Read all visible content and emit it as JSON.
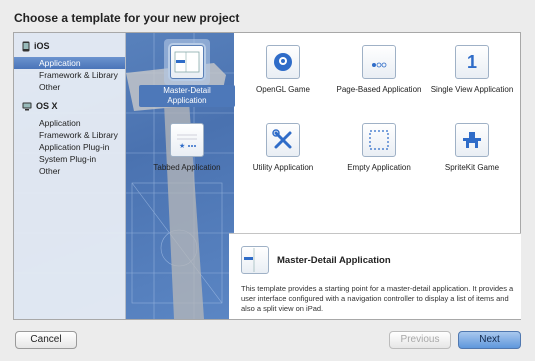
{
  "dialog": {
    "title": "Choose a template for your new project"
  },
  "sidebar": {
    "sections": [
      {
        "name": "iOS",
        "items": [
          "Application",
          "Framework & Library",
          "Other"
        ],
        "selected_index": 0
      },
      {
        "name": "OS X",
        "items": [
          "Application",
          "Framework & Library",
          "Application Plug-in",
          "System Plug-in",
          "Other"
        ]
      }
    ]
  },
  "templates": [
    {
      "label": "Master-Detail Application",
      "icon": "master-detail-icon",
      "selected": true
    },
    {
      "label": "OpenGL Game",
      "icon": "opengl-icon"
    },
    {
      "label": "Page-Based Application",
      "icon": "page-based-icon"
    },
    {
      "label": "Single View Application",
      "icon": "single-view-icon",
      "glyph": "1"
    },
    {
      "label": "Tabbed Application",
      "icon": "tabbed-icon"
    },
    {
      "label": "Utility Application",
      "icon": "utility-icon"
    },
    {
      "label": "Empty Application",
      "icon": "empty-icon"
    },
    {
      "label": "SpriteKit Game",
      "icon": "spritekit-icon"
    }
  ],
  "detail": {
    "title": "Master-Detail Application",
    "description": "This template provides a starting point for a master-detail application. It provides a user interface configured with a navigation controller to display a list of items and also a split view on iPad."
  },
  "buttons": {
    "cancel": "Cancel",
    "previous": "Previous",
    "next": "Next"
  },
  "colors": {
    "accent": "#4d78b9",
    "blueprint": "#4a72b0",
    "primary_button": "#5f97dc"
  }
}
